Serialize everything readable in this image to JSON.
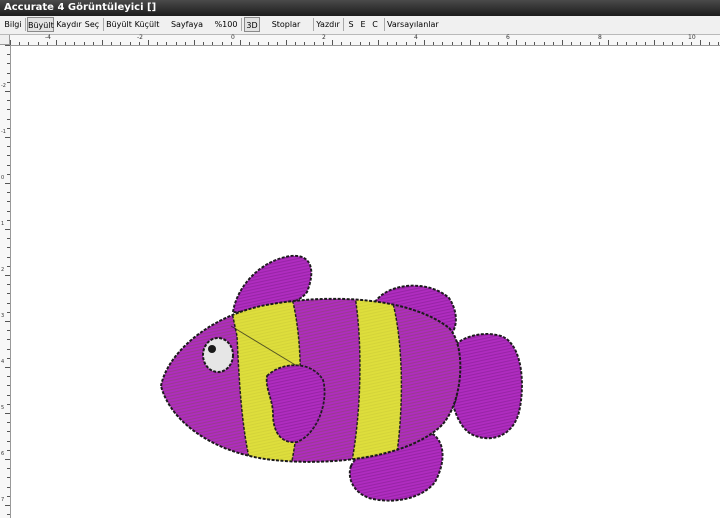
{
  "window": {
    "title": "Accurate 4 Görüntüleyici []"
  },
  "toolbar": {
    "buttons": [
      {
        "id": "bilgi",
        "label": "Bilgi"
      },
      {
        "id": "buyult-mode",
        "label": "Büyült"
      },
      {
        "id": "kaydir",
        "label": "Kaydır"
      },
      {
        "id": "sec",
        "label": "Seç"
      },
      {
        "id": "buyult",
        "label": "Büyült"
      },
      {
        "id": "kucult",
        "label": "Küçült"
      },
      {
        "id": "sayfaya-sigdir",
        "label": "Sayfaya Sığdır"
      },
      {
        "id": "zoom-100",
        "label": "%100"
      },
      {
        "id": "3d",
        "label": "3D"
      },
      {
        "id": "stoplar-renkli",
        "label": "Stoplar Renkli"
      },
      {
        "id": "yazdir",
        "label": "Yazdır"
      },
      {
        "id": "s",
        "label": "S"
      },
      {
        "id": "e",
        "label": "E"
      },
      {
        "id": "c",
        "label": "C"
      },
      {
        "id": "varsayilanlar",
        "label": "Varsayılanlar"
      }
    ]
  },
  "ruler": {
    "horizontal_labels": [
      "-4",
      "-2",
      "0",
      "2",
      "4",
      "6",
      "8",
      "10"
    ],
    "vertical_labels": [
      "-2",
      "-1",
      "0",
      "1",
      "2",
      "3",
      "4",
      "5",
      "6",
      "7",
      "8",
      "9"
    ]
  },
  "colors": {
    "fish_body": "#b02cc0",
    "fish_stripe": "#dede3c",
    "outline": "#1a1a1a",
    "eye": "#e6e6e6"
  },
  "icons": {
    "canvas_image": "clownfish-embroidery"
  }
}
